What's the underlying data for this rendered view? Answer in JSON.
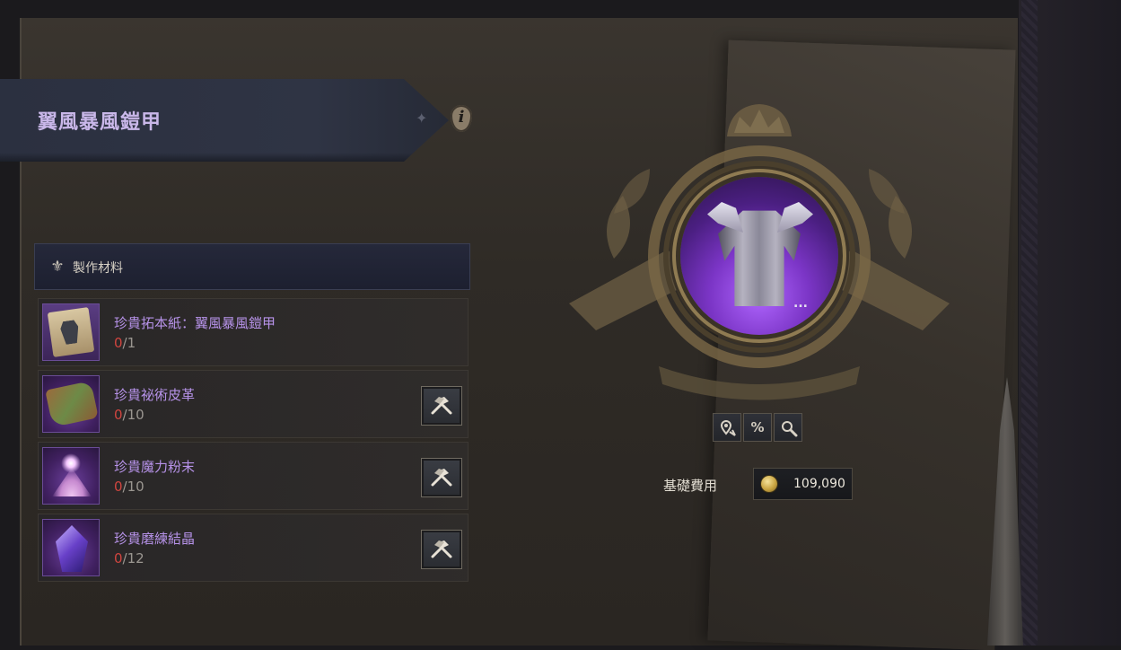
{
  "item": {
    "title": "翼風暴風鎧甲"
  },
  "materials": {
    "header": "製作材料",
    "items": [
      {
        "name": "珍貴拓本紙：翼風暴風鎧甲",
        "have": "0",
        "need": "/1",
        "craftable": false,
        "icon": "rubbing-paper-icon"
      },
      {
        "name": "珍貴祕術皮革",
        "have": "0",
        "need": "/10",
        "craftable": true,
        "icon": "arcane-leather-icon"
      },
      {
        "name": "珍貴魔力粉末",
        "have": "0",
        "need": "/10",
        "craftable": true,
        "icon": "magic-powder-icon"
      },
      {
        "name": "珍貴磨練結晶",
        "have": "0",
        "need": "/12",
        "craftable": true,
        "icon": "polishing-crystal-icon"
      }
    ]
  },
  "portrait": {
    "more_label": "..."
  },
  "actions": {
    "icons": [
      "map-pin-icon",
      "percent-icon",
      "search-icon"
    ],
    "percent_label": "%"
  },
  "cost": {
    "label": "基礎費用",
    "value": "109,090",
    "currency_icon": "gold-coin-icon"
  },
  "colors": {
    "item_name": "#b692e8",
    "insufficient": "#d0453f",
    "title": "#c9b7e9"
  }
}
